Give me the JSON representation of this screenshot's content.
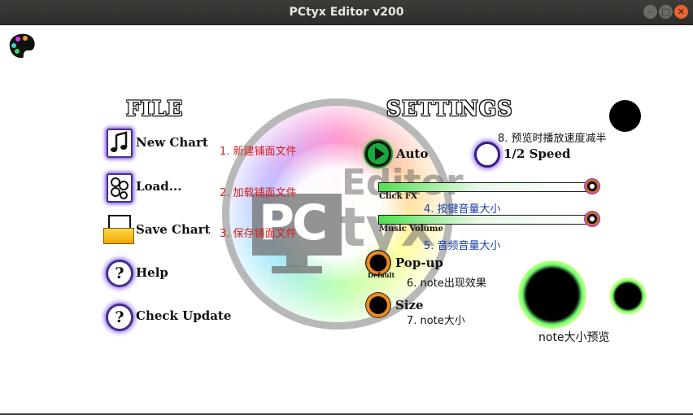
{
  "window": {
    "title": "PCtyx Editor v200"
  },
  "logo_text": {
    "line1": "Editor",
    "line2": "PC",
    "line3": "tyx"
  },
  "file": {
    "heading": "FILE",
    "items": [
      {
        "label": "New Chart",
        "note": "1. 新建铺面文件"
      },
      {
        "label": "Load...",
        "note": "2. 加载铺面文件"
      },
      {
        "label": "Save Chart",
        "note": "3. 保存铺面文件"
      },
      {
        "label": "Help"
      },
      {
        "label": "Check Update"
      }
    ],
    "help_glyph": "?"
  },
  "settings": {
    "heading": "SETTINGS",
    "auto_label": "Auto",
    "half_speed_label": "1/2 Speed",
    "half_speed_note": "8. 预览时播放速度减半",
    "click_fx": {
      "label": "Click FX",
      "note": "4. 按键音量大小",
      "level": 0.98
    },
    "music_volume": {
      "label": "Music Volume",
      "note": "5. 音频音量大小",
      "level": 0.98
    },
    "popup": {
      "label": "Pop-up",
      "sub": "Default",
      "note": "6. note出现效果"
    },
    "size": {
      "label": "Size",
      "note": "7. note大小"
    },
    "preview_label": "note大小预览"
  }
}
